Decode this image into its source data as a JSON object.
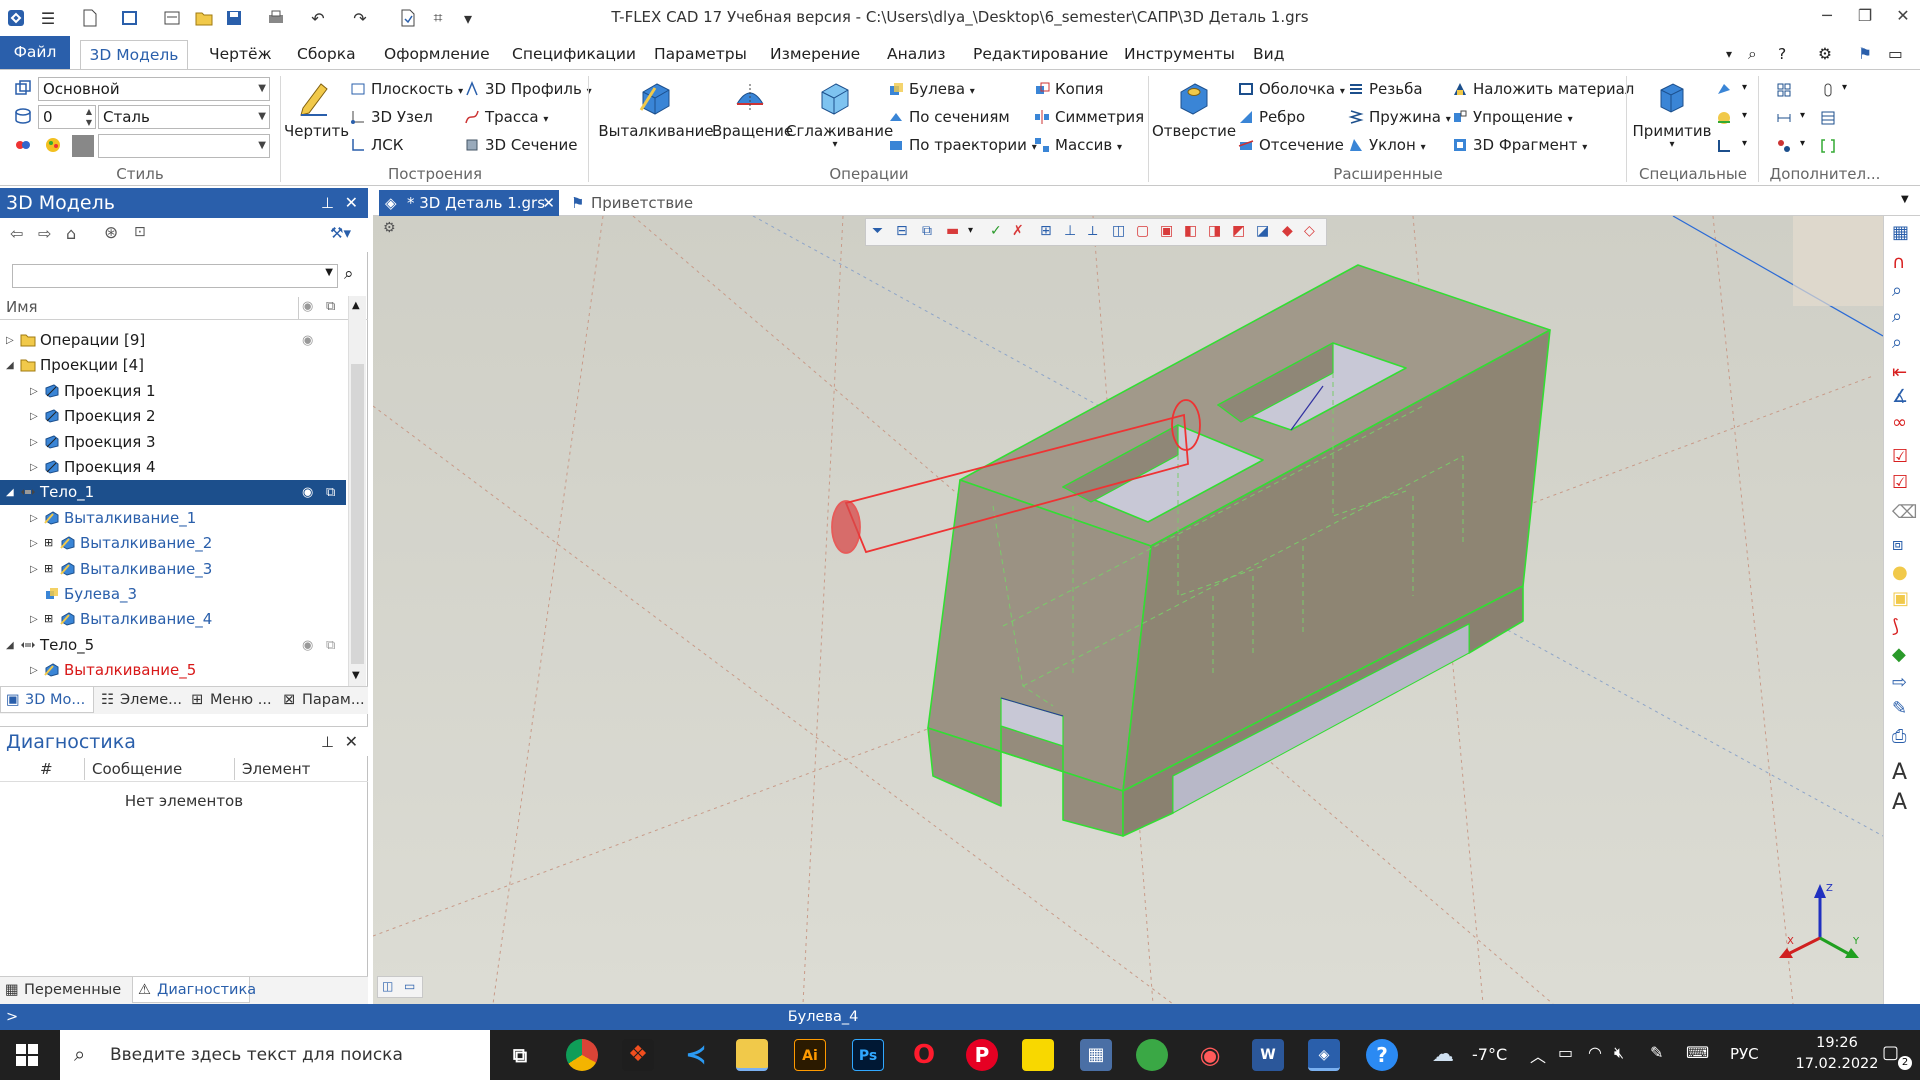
{
  "window": {
    "title": "T-FLEX CAD 17 Учебная версия - C:\\Users\\dlya_\\Desktop\\6_semester\\САПР\\3D Деталь 1.grs"
  },
  "ribbon_tabs": {
    "file": "Файл",
    "items": [
      "3D Модель",
      "Чертёж",
      "Сборка",
      "Оформление",
      "Спецификации",
      "Параметры",
      "Измерение",
      "Анализ",
      "Редактирование",
      "Инструменты",
      "Вид"
    ]
  },
  "style_group": {
    "layer_value": "Основной",
    "level_value": "0",
    "material_value": "Сталь",
    "label": "Стиль"
  },
  "construct_group": {
    "draw": "Чертить",
    "plane": "Плоскость",
    "node": "3D Узел",
    "lcs": "ЛСК",
    "profile": "3D Профиль",
    "path": "Трасса",
    "section": "3D Сечение",
    "label": "Построения"
  },
  "operations_group": {
    "extrude": "Выталкивание",
    "rotate": "Вращение",
    "smooth": "Сглаживание",
    "boolean": "Булева",
    "by_sections": "По сечениям",
    "by_path": "По траектории",
    "copy": "Копия",
    "symmetry": "Симметрия",
    "array": "Массив",
    "label": "Операции"
  },
  "extended_group": {
    "hole": "Отверстие",
    "shell": "Оболочка",
    "rib": "Ребро",
    "cut": "Отсечение",
    "thread": "Резьба",
    "spring": "Пружина",
    "slope": "Уклон",
    "material": "Наложить материал",
    "simplify": "Упрощение",
    "fragment": "3D Фрагмент",
    "label": "Расширенные"
  },
  "special_group": {
    "primitive": "Примитив",
    "label": "Специальные",
    "extra_label": "Дополнител..."
  },
  "model_panel": {
    "title": "3D Модель",
    "column_name": "Имя",
    "tree": [
      {
        "label": "Операции [9]",
        "level": 0,
        "icon": "folder",
        "color": "normal"
      },
      {
        "label": "Проекции [4]",
        "level": 0,
        "icon": "folder",
        "color": "normal"
      },
      {
        "label": "Проекция 1",
        "level": 1,
        "icon": "projection",
        "color": "normal"
      },
      {
        "label": "Проекция 2",
        "level": 1,
        "icon": "projection",
        "color": "normal"
      },
      {
        "label": "Проекция 3",
        "level": 1,
        "icon": "projection",
        "color": "normal"
      },
      {
        "label": "Проекция 4",
        "level": 1,
        "icon": "projection",
        "color": "normal"
      },
      {
        "label": "Тело_1",
        "level": 0,
        "icon": "body",
        "color": "selected"
      },
      {
        "label": "Выталкивание_1",
        "level": 1,
        "icon": "extrude",
        "color": "blue"
      },
      {
        "label": "Выталкивание_2",
        "level": 1,
        "icon": "extrude2",
        "color": "blue"
      },
      {
        "label": "Выталкивание_3",
        "level": 1,
        "icon": "extrude2",
        "color": "blue"
      },
      {
        "label": "Булева_3",
        "level": 1,
        "icon": "boolean",
        "color": "blue"
      },
      {
        "label": "Выталкивание_4",
        "level": 1,
        "icon": "extrude2",
        "color": "blue"
      },
      {
        "label": "Тело_5",
        "level": 0,
        "icon": "body",
        "color": "normal"
      },
      {
        "label": "Выталкивание_5",
        "level": 1,
        "icon": "extrude",
        "color": "red"
      }
    ],
    "bottom_tabs": [
      "3D Мо...",
      "Элеме...",
      "Меню ...",
      "Парам..."
    ]
  },
  "diagnostics_panel": {
    "title": "Диагностика",
    "columns": [
      "#",
      "Сообщение",
      "Элемент"
    ],
    "empty_text": "Нет элементов",
    "bottom_tabs": [
      "Переменные",
      "Диагностика"
    ]
  },
  "doc_tabs": {
    "active": "* 3D Деталь 1.grs",
    "second": "Приветствие"
  },
  "status": {
    "prompt": ">",
    "text": "Булева_4"
  },
  "taskbar": {
    "search_placeholder": "Введите здесь текст для поиска",
    "temperature": "-7°C",
    "language": "РУС",
    "time": "19:26",
    "date": "17.02.2022",
    "notifications": "2"
  },
  "axis_labels": {
    "x": "X",
    "y": "Y",
    "z": "Z"
  },
  "colors": {
    "accent": "#2a5fab",
    "viewport_bg": "#d4d4cc",
    "body_face": "#9b9283",
    "edge_green": "#33dd33",
    "cylinder_red": "#ee3333"
  }
}
